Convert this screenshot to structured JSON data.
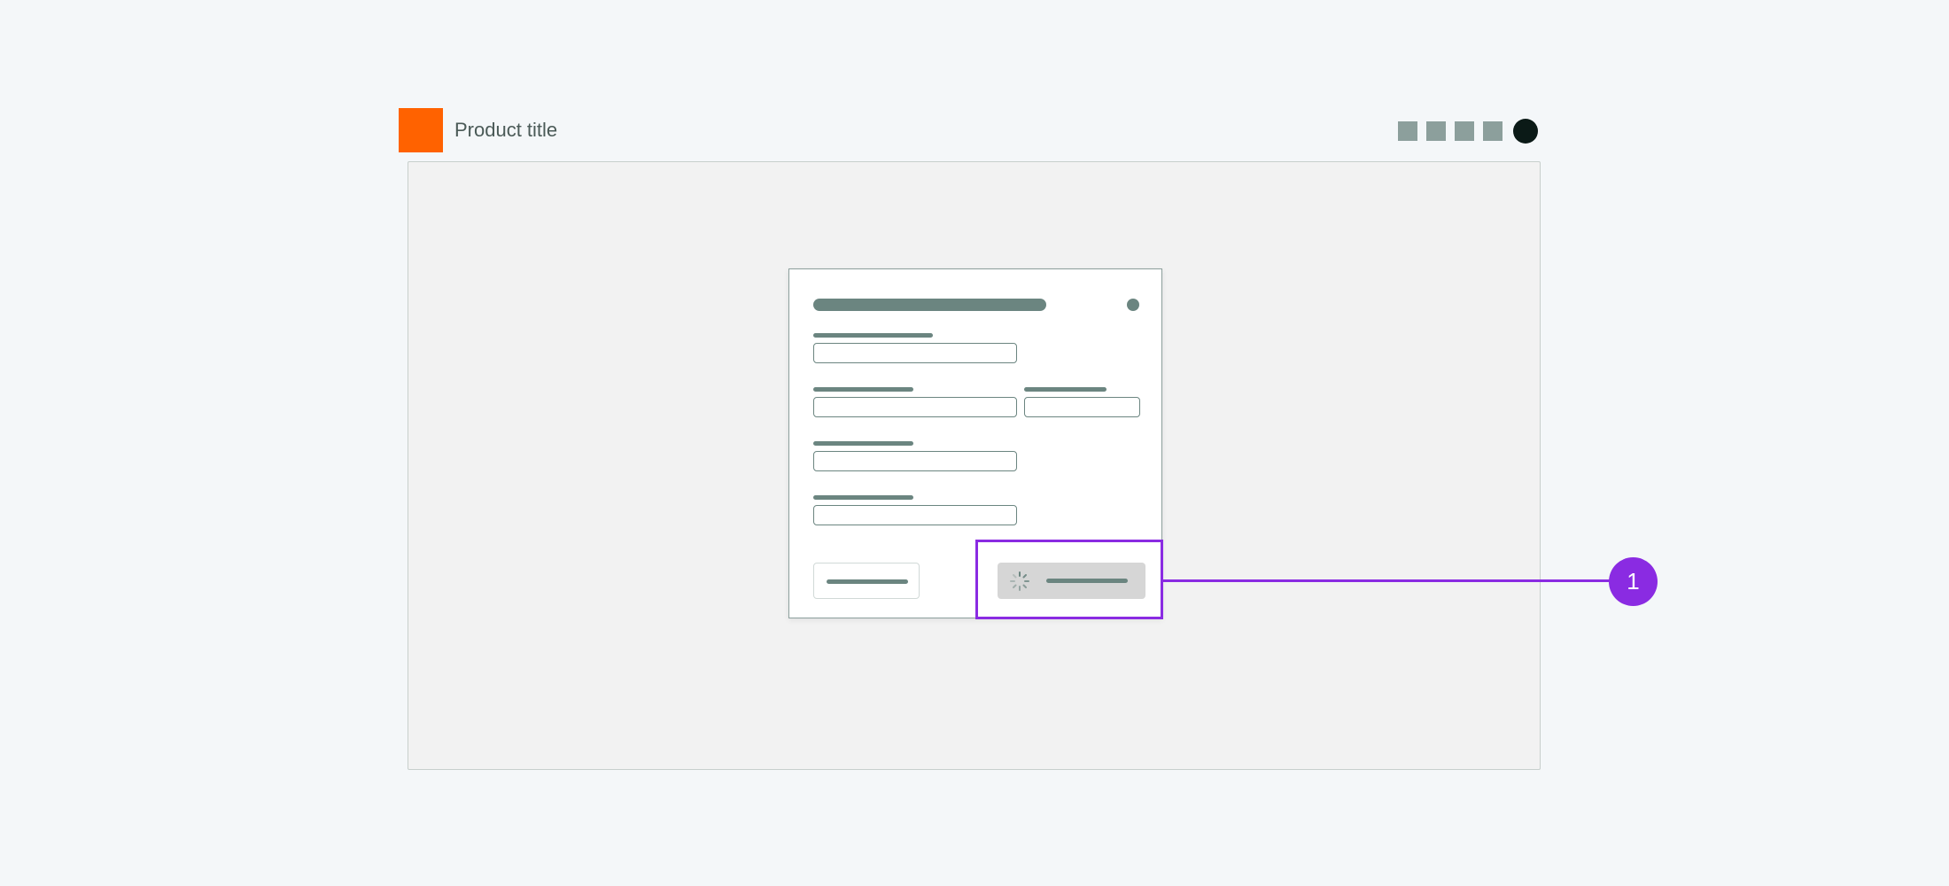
{
  "header": {
    "product_title": "Product title",
    "logo_color": "#ff6200",
    "icons": [
      "header-icon-1",
      "header-icon-2",
      "header-icon-3",
      "header-icon-4",
      "user-avatar"
    ]
  },
  "modal": {
    "title": "",
    "fields": [
      "field-1",
      "field-2",
      "field-3",
      "field-4",
      "field-5"
    ],
    "secondary_button": "",
    "primary_button": "",
    "primary_state": "loading"
  },
  "callout": {
    "number": "1",
    "color": "#8a2be2"
  }
}
